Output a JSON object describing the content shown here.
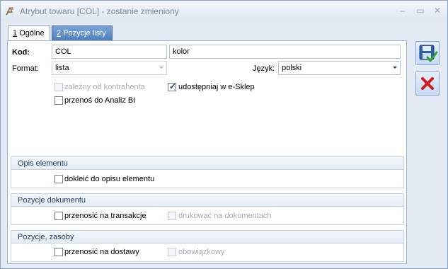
{
  "window": {
    "title": "Atrybut towaru [COL] - zostanie zmieniony"
  },
  "tabs": [
    {
      "number": "1",
      "label": "Ogólne"
    },
    {
      "number": "2",
      "label": "Pozycje listy"
    }
  ],
  "form": {
    "kod_label": "Kod:",
    "kod_value": "COL",
    "nazwa_value": "kolor",
    "format_label": "Format:",
    "format_value": "lista",
    "jezyk_label": "Język:",
    "jezyk_value": "polski",
    "zalezny_label": "zależny od kontrahenta",
    "eskelp_label": "udostępniaj w e-Sklep",
    "analiz_label": "przenoś do Analiz BI"
  },
  "sections": {
    "opis": {
      "title": "Opis elementu",
      "checkbox": "dokleić do opisu elementu"
    },
    "pozycje_dok": {
      "title": "Pozycje dokumentu",
      "checkbox1": "przenosić na transakcje",
      "checkbox2": "drukować na dokumentach"
    },
    "pozycje_zas": {
      "title": "Pozycje, zasoby",
      "checkbox1": "przenosić na dostawy",
      "checkbox2": "obowiązkowy"
    }
  },
  "state": {
    "zalezny_checked": false,
    "eskelp_checked": true,
    "analiz_checked": false
  },
  "colors": {
    "accent": "#4f7fbf",
    "border": "#8ea3c0",
    "panel_bg": "#ffffff"
  },
  "icons": {
    "save": "save-icon",
    "cancel": "close-icon",
    "app": "app-icon"
  }
}
